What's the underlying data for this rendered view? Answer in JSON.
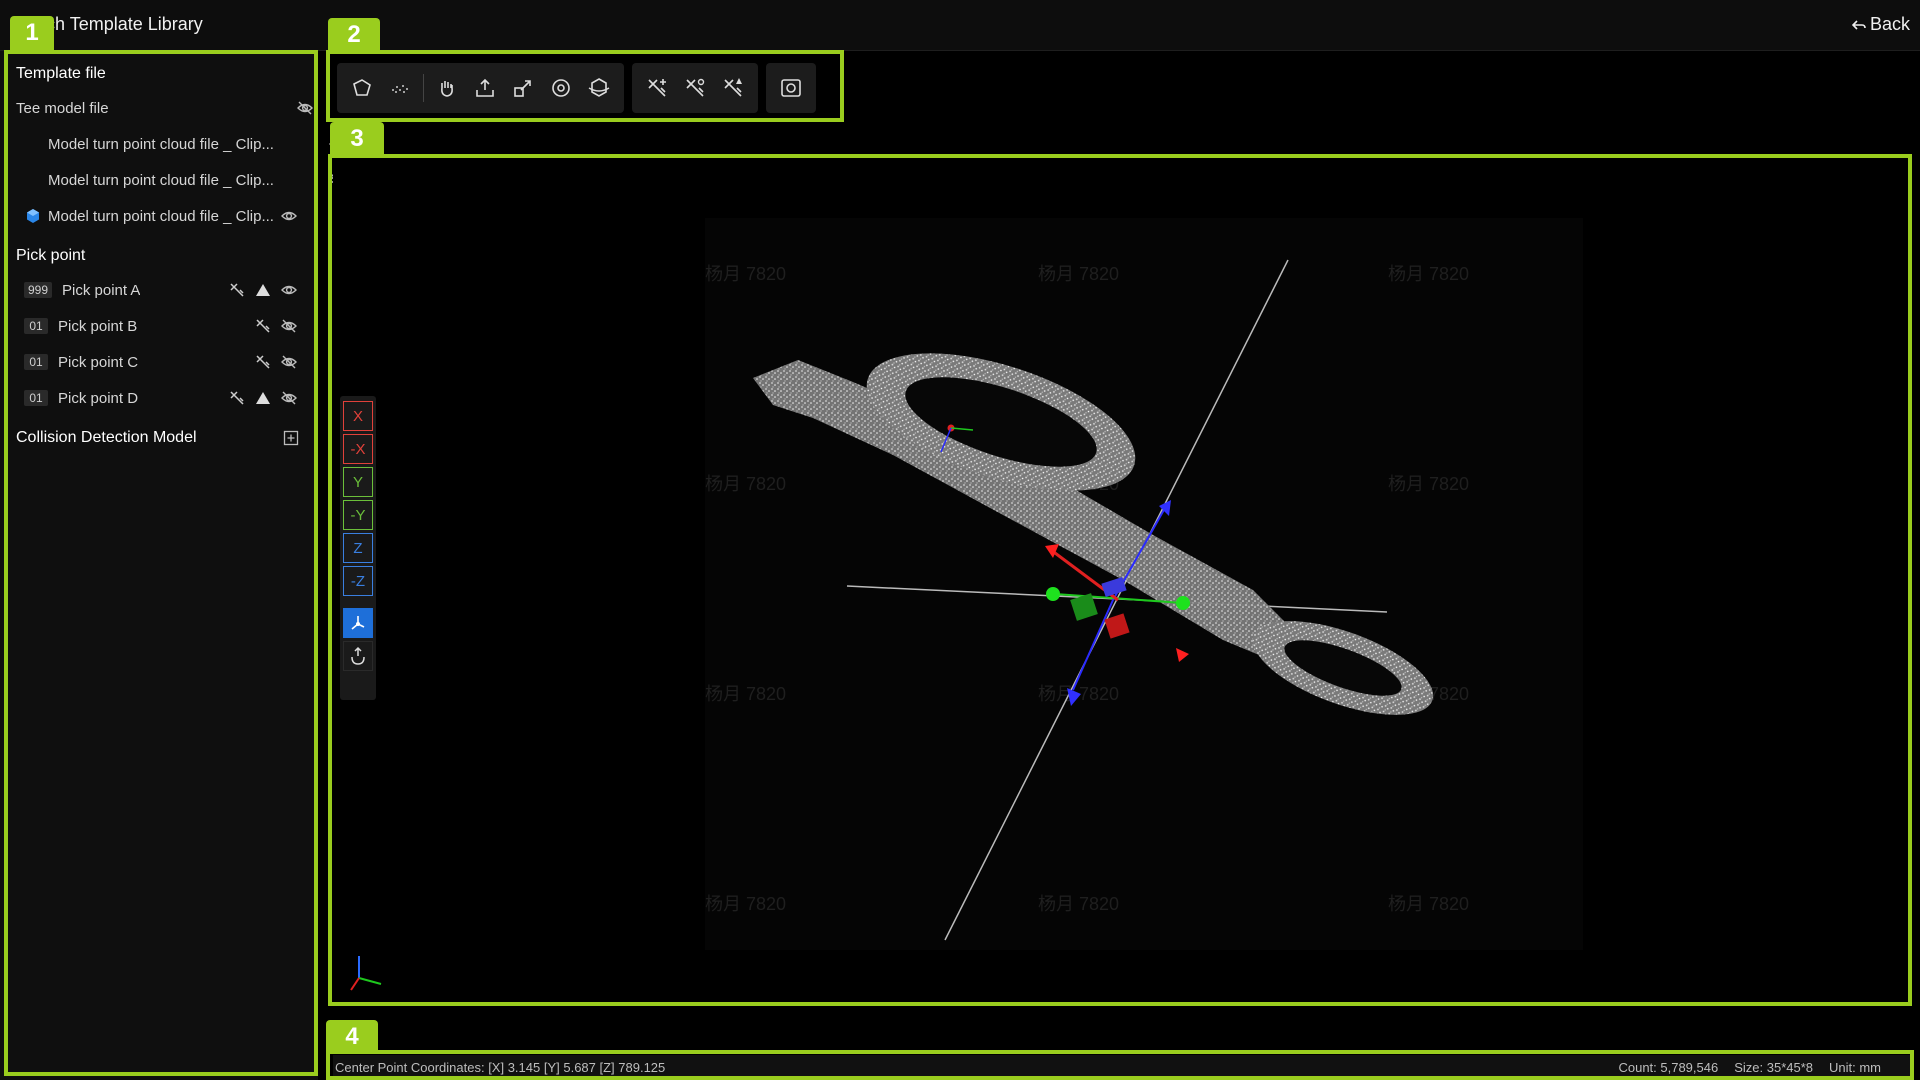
{
  "app": {
    "title": "Match Template Library",
    "back_label": "Back"
  },
  "annotations": [
    "1",
    "2",
    "3",
    "4"
  ],
  "sidebar": {
    "template_section": "Template file",
    "model_root": "Tee model file",
    "model_files": [
      "Model turn point cloud file _ Clip...",
      "Model turn point cloud file _ Clip...",
      "Model turn point cloud file _ Clip..."
    ],
    "pick_section": "Pick point",
    "pick_points": [
      {
        "badge": "999",
        "label": "Pick point A"
      },
      {
        "badge": "01",
        "label": "Pick point B"
      },
      {
        "badge": "01",
        "label": "Pick point C"
      },
      {
        "badge": "01",
        "label": "Pick point D"
      }
    ],
    "collision_section": "Collision Detection Model"
  },
  "axes": [
    "X",
    "-X",
    "Y",
    "-Y",
    "Z",
    "-Z"
  ],
  "watermark": "杨月 7820",
  "status": {
    "center": "Center Point Coordinates: [X] 3.145 [Y] 5.687 [Z] 789.125",
    "count": "Count: 5,789,546",
    "size": "Size: 35*45*8",
    "unit": "Unit: mm"
  },
  "colors": {
    "highlight": "#9acd1e",
    "x_axis": "#e0413a",
    "y_axis": "#6bbf3a",
    "z_axis": "#3a7fe0",
    "active": "#1e6fd9"
  }
}
